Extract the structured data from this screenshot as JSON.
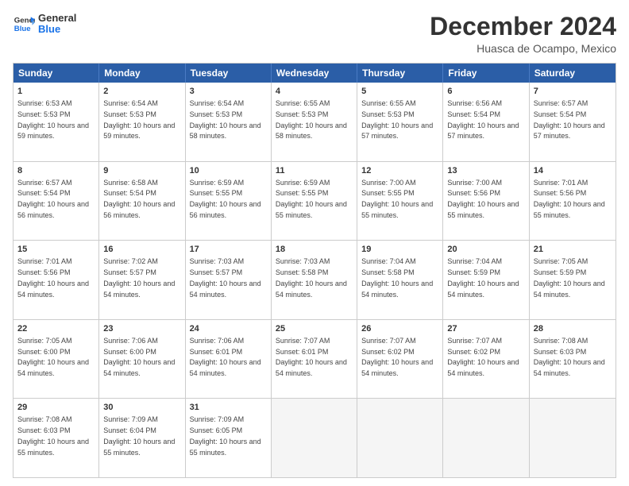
{
  "logo": {
    "line1": "General",
    "line2": "Blue"
  },
  "title": "December 2024",
  "location": "Huasca de Ocampo, Mexico",
  "days": [
    "Sunday",
    "Monday",
    "Tuesday",
    "Wednesday",
    "Thursday",
    "Friday",
    "Saturday"
  ],
  "weeks": [
    [
      {
        "num": "1",
        "sunrise": "6:53 AM",
        "sunset": "5:53 PM",
        "daylight": "10 hours and 59 minutes."
      },
      {
        "num": "2",
        "sunrise": "6:54 AM",
        "sunset": "5:53 PM",
        "daylight": "10 hours and 59 minutes."
      },
      {
        "num": "3",
        "sunrise": "6:54 AM",
        "sunset": "5:53 PM",
        "daylight": "10 hours and 58 minutes."
      },
      {
        "num": "4",
        "sunrise": "6:55 AM",
        "sunset": "5:53 PM",
        "daylight": "10 hours and 58 minutes."
      },
      {
        "num": "5",
        "sunrise": "6:55 AM",
        "sunset": "5:53 PM",
        "daylight": "10 hours and 57 minutes."
      },
      {
        "num": "6",
        "sunrise": "6:56 AM",
        "sunset": "5:54 PM",
        "daylight": "10 hours and 57 minutes."
      },
      {
        "num": "7",
        "sunrise": "6:57 AM",
        "sunset": "5:54 PM",
        "daylight": "10 hours and 57 minutes."
      }
    ],
    [
      {
        "num": "8",
        "sunrise": "6:57 AM",
        "sunset": "5:54 PM",
        "daylight": "10 hours and 56 minutes."
      },
      {
        "num": "9",
        "sunrise": "6:58 AM",
        "sunset": "5:54 PM",
        "daylight": "10 hours and 56 minutes."
      },
      {
        "num": "10",
        "sunrise": "6:59 AM",
        "sunset": "5:55 PM",
        "daylight": "10 hours and 56 minutes."
      },
      {
        "num": "11",
        "sunrise": "6:59 AM",
        "sunset": "5:55 PM",
        "daylight": "10 hours and 55 minutes."
      },
      {
        "num": "12",
        "sunrise": "7:00 AM",
        "sunset": "5:55 PM",
        "daylight": "10 hours and 55 minutes."
      },
      {
        "num": "13",
        "sunrise": "7:00 AM",
        "sunset": "5:56 PM",
        "daylight": "10 hours and 55 minutes."
      },
      {
        "num": "14",
        "sunrise": "7:01 AM",
        "sunset": "5:56 PM",
        "daylight": "10 hours and 55 minutes."
      }
    ],
    [
      {
        "num": "15",
        "sunrise": "7:01 AM",
        "sunset": "5:56 PM",
        "daylight": "10 hours and 54 minutes."
      },
      {
        "num": "16",
        "sunrise": "7:02 AM",
        "sunset": "5:57 PM",
        "daylight": "10 hours and 54 minutes."
      },
      {
        "num": "17",
        "sunrise": "7:03 AM",
        "sunset": "5:57 PM",
        "daylight": "10 hours and 54 minutes."
      },
      {
        "num": "18",
        "sunrise": "7:03 AM",
        "sunset": "5:58 PM",
        "daylight": "10 hours and 54 minutes."
      },
      {
        "num": "19",
        "sunrise": "7:04 AM",
        "sunset": "5:58 PM",
        "daylight": "10 hours and 54 minutes."
      },
      {
        "num": "20",
        "sunrise": "7:04 AM",
        "sunset": "5:59 PM",
        "daylight": "10 hours and 54 minutes."
      },
      {
        "num": "21",
        "sunrise": "7:05 AM",
        "sunset": "5:59 PM",
        "daylight": "10 hours and 54 minutes."
      }
    ],
    [
      {
        "num": "22",
        "sunrise": "7:05 AM",
        "sunset": "6:00 PM",
        "daylight": "10 hours and 54 minutes."
      },
      {
        "num": "23",
        "sunrise": "7:06 AM",
        "sunset": "6:00 PM",
        "daylight": "10 hours and 54 minutes."
      },
      {
        "num": "24",
        "sunrise": "7:06 AM",
        "sunset": "6:01 PM",
        "daylight": "10 hours and 54 minutes."
      },
      {
        "num": "25",
        "sunrise": "7:07 AM",
        "sunset": "6:01 PM",
        "daylight": "10 hours and 54 minutes."
      },
      {
        "num": "26",
        "sunrise": "7:07 AM",
        "sunset": "6:02 PM",
        "daylight": "10 hours and 54 minutes."
      },
      {
        "num": "27",
        "sunrise": "7:07 AM",
        "sunset": "6:02 PM",
        "daylight": "10 hours and 54 minutes."
      },
      {
        "num": "28",
        "sunrise": "7:08 AM",
        "sunset": "6:03 PM",
        "daylight": "10 hours and 54 minutes."
      }
    ],
    [
      {
        "num": "29",
        "sunrise": "7:08 AM",
        "sunset": "6:03 PM",
        "daylight": "10 hours and 55 minutes."
      },
      {
        "num": "30",
        "sunrise": "7:09 AM",
        "sunset": "6:04 PM",
        "daylight": "10 hours and 55 minutes."
      },
      {
        "num": "31",
        "sunrise": "7:09 AM",
        "sunset": "6:05 PM",
        "daylight": "10 hours and 55 minutes."
      },
      null,
      null,
      null,
      null
    ]
  ]
}
